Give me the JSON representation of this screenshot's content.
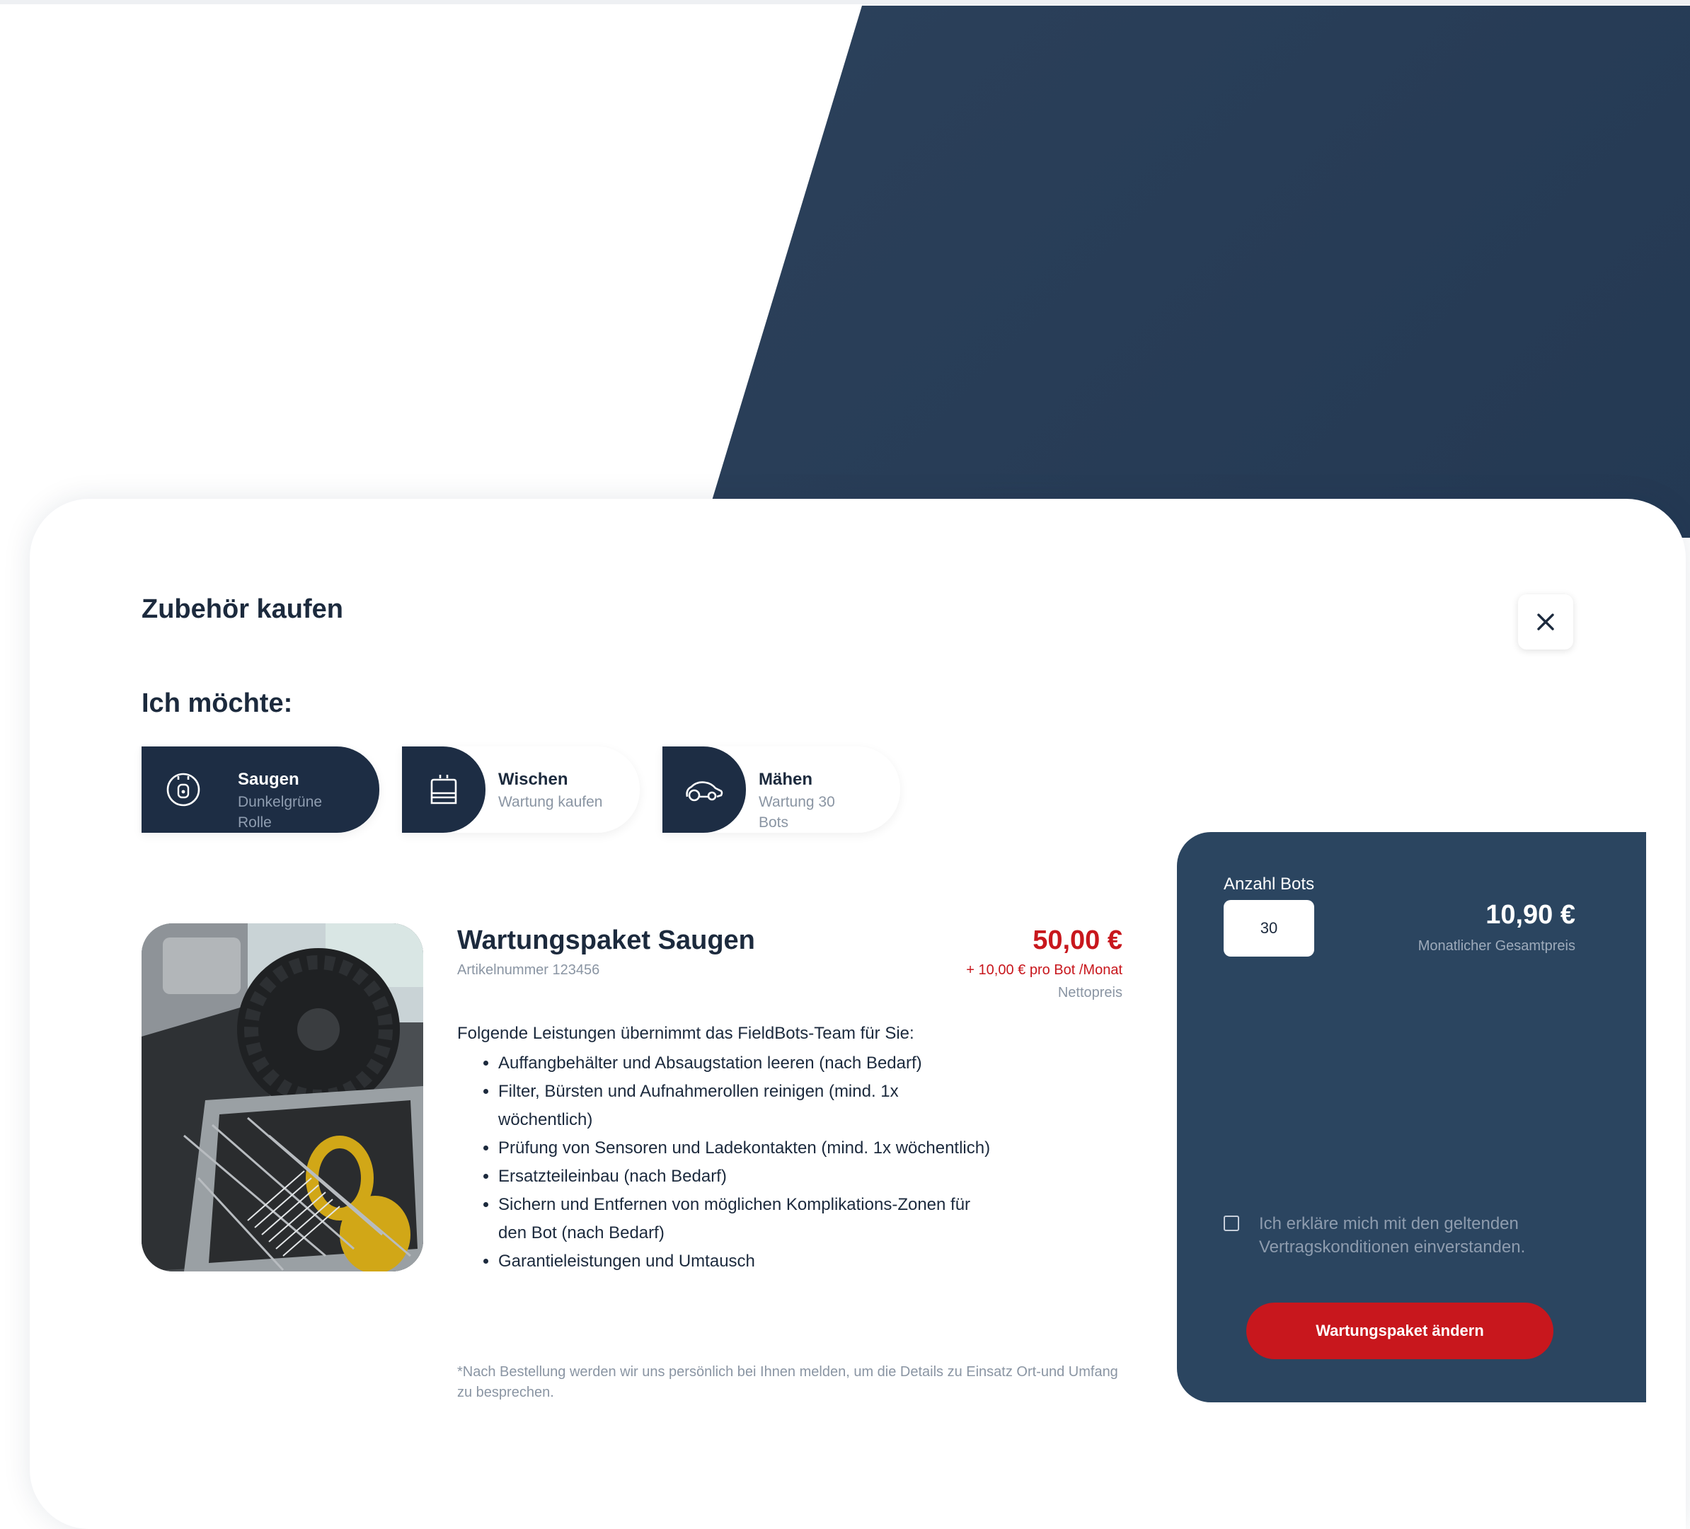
{
  "modal": {
    "title": "Zubehör kaufen",
    "subtitle": "Ich möchte:",
    "close_icon": "close-icon"
  },
  "options": [
    {
      "title": "Saugen",
      "subtitle": "Dunkelgrüne Rolle",
      "icon": "vacuum-robot-icon",
      "active": true
    },
    {
      "title": "Wischen",
      "subtitle": "Wartung kaufen",
      "icon": "mop-icon",
      "active": false
    },
    {
      "title": "Mähen",
      "subtitle": "Wartung 30 Bots",
      "icon": "mower-icon",
      "active": false
    }
  ],
  "product": {
    "name": "Wartungspaket Saugen",
    "article_number": "Artikelnummer 123456",
    "price": "50,00 €",
    "price_per": "+ 10,00 € pro Bot /Monat",
    "price_note": "Nettopreis",
    "description_intro": "Folgende Leistungen übernimmt das FieldBots-Team für Sie:",
    "services": [
      "Auffangbehälter und Absaugstation leeren  (nach Bedarf)",
      "Filter, Bürsten und Aufnahmerollen reinigen (mind. 1x wöchentlich)",
      "Prüfung von Sensoren und Ladekontakten (mind. 1x wöchentlich)",
      "Ersatzteileinbau (nach Bedarf)",
      "Sichern und Entfernen von möglichen Komplikations-Zonen für den Bot (nach Bedarf)",
      "Garantieleistungen und Umtausch"
    ],
    "footnote": "*Nach Bestellung werden wir uns persönlich bei Ihnen melden, um die Details zu Einsatz Ort-und Umfang zu besprechen."
  },
  "order": {
    "bots_label": "Anzahl Bots",
    "bots_value": "30",
    "total_price": "10,90 €",
    "total_label": "Monatlicher Gesamtpreis",
    "consent": "Ich erkläre mich mit den geltenden Vertragskonditionen einverstanden.",
    "consent_checked": false,
    "submit_label": "Wartungspaket ändern"
  },
  "colors": {
    "navy": "#1d2d44",
    "panel": "#2b4560",
    "accent_red": "#c8171d",
    "muted": "#8a95a3"
  }
}
